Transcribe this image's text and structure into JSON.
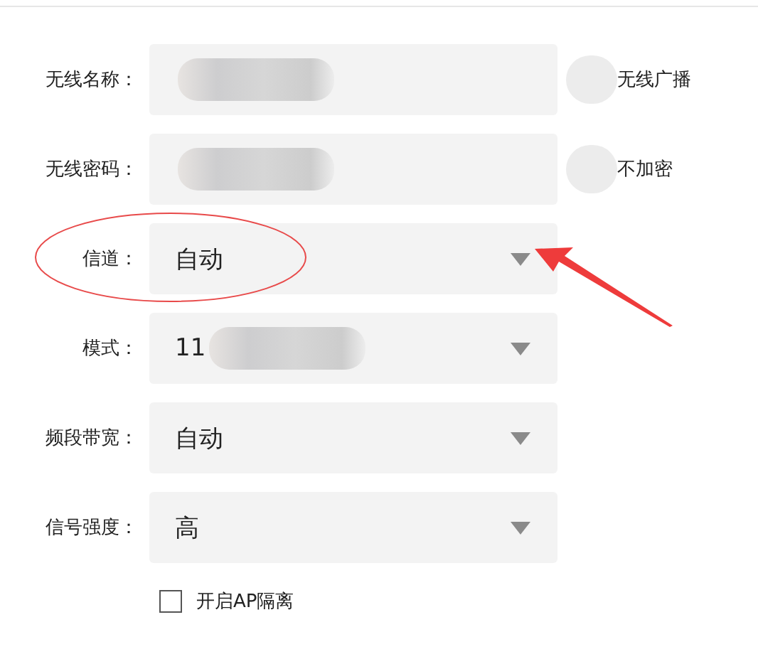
{
  "fields": [
    {
      "kind": "text",
      "label": "无线名称：",
      "redacted": true,
      "side": {
        "text": "无线广播",
        "redacted": true
      }
    },
    {
      "kind": "text",
      "label": "无线密码：",
      "redacted": true,
      "side": {
        "text": "不加密",
        "redacted": true
      }
    },
    {
      "kind": "select",
      "label": "信道：",
      "value": "自动"
    },
    {
      "kind": "select",
      "label": "模式：",
      "value": "11",
      "redacted": true
    },
    {
      "kind": "select",
      "label": "频段带宽：",
      "value": "自动"
    },
    {
      "kind": "select",
      "label": "信号强度：",
      "value": "高"
    }
  ],
  "ap_isolation": {
    "label": "开启AP隔离",
    "checked": false
  },
  "annotations": {
    "ellipse": true,
    "arrow": true
  }
}
